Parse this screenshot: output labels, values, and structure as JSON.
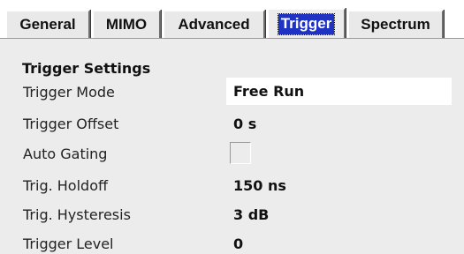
{
  "tabs": [
    {
      "label": "General",
      "active": false
    },
    {
      "label": "MIMO",
      "active": false
    },
    {
      "label": "Advanced",
      "active": false
    },
    {
      "label": "Trigger",
      "active": true
    },
    {
      "label": "Spectrum",
      "active": false
    }
  ],
  "section": {
    "title": "Trigger Settings"
  },
  "settings": {
    "trigger_mode": {
      "label": "Trigger Mode",
      "value": "Free Run"
    },
    "trigger_offset": {
      "label": "Trigger Offset",
      "value": "0 s"
    },
    "auto_gating": {
      "label": "Auto Gating",
      "checked": false
    },
    "trig_holdoff": {
      "label": "Trig. Holdoff",
      "value": "150 ns"
    },
    "trig_hysteresis": {
      "label": "Trig. Hysteresis",
      "value": "3 dB"
    },
    "trigger_level": {
      "label": "Trigger Level",
      "value": "0"
    }
  },
  "colors": {
    "active_tab_highlight": "#1e32c4",
    "panel_background": "#ececec",
    "tab_background": "#e9e9e9"
  }
}
